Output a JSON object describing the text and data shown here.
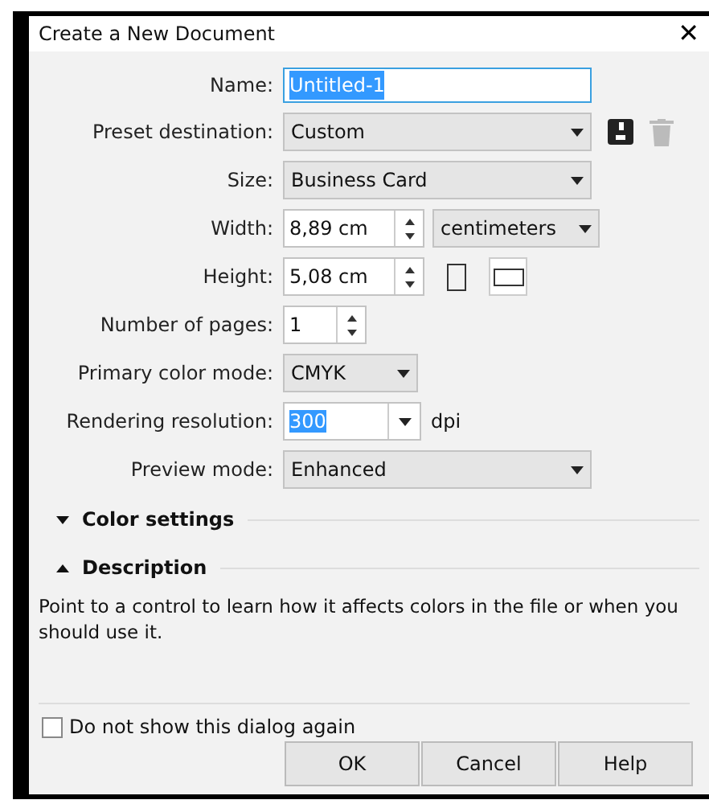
{
  "window": {
    "title": "Create a New Document",
    "close": "✕"
  },
  "fields": [
    {
      "kind": "text",
      "label": "Name:",
      "value": "Untitled-1",
      "text_selected": true
    },
    {
      "kind": "dropdown",
      "label": "Preset destination:",
      "value": "Custom",
      "preset_actions": true,
      "delete_disabled": true
    },
    {
      "kind": "dropdown",
      "label": "Size:",
      "value": "Business Card"
    },
    {
      "kind": "spinner",
      "label": "Width:",
      "value": "8,89 cm",
      "unit": "centimeters"
    },
    {
      "kind": "spinner",
      "label": "Height:",
      "value": "5,08 cm",
      "orientations": [
        {
          "kind": "portrait",
          "selected": false
        },
        {
          "kind": "landscape",
          "selected": true
        }
      ]
    },
    {
      "kind": "spinner",
      "label": "Number of pages:",
      "value": "1"
    },
    {
      "kind": "smalldropdown",
      "label": "Primary color mode:",
      "value": "CMYK"
    },
    {
      "kind": "combo",
      "label": "Rendering resolution:",
      "value": "300",
      "text_selected": true,
      "suffix": "dpi"
    },
    {
      "kind": "dropdown",
      "label": "Preview mode:",
      "value": "Enhanced"
    }
  ],
  "sections": [
    {
      "title": "Color settings",
      "expanded": false
    },
    {
      "title": "Description",
      "expanded": true,
      "text": "Point to a control to learn how it affects colors in the file or when you should use it."
    }
  ],
  "dont_show_again": {
    "label": "Do not show this dialog again",
    "checked": false
  },
  "buttons": [
    "OK",
    "Cancel",
    "Help"
  ]
}
